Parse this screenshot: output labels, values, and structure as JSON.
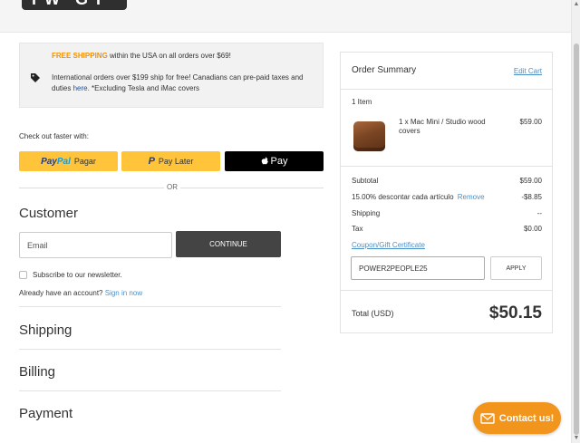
{
  "header": {
    "logo_text": "TW GT"
  },
  "notice": {
    "free_highlight": "FREE SHIPPING",
    "free_rest": " within the USA on all orders over $69!",
    "intl_text_1": "International orders over $199 ship for free! Canadians can pre-paid taxes and duties ",
    "intl_link": "here.",
    "intl_text_2": " *Excluding Tesla and iMac covers",
    "tag_icon": "tag-icon"
  },
  "express": {
    "label": "Check out faster with:",
    "paypal_logo_1": "Pay",
    "paypal_logo_2": "Pal",
    "paypal_suffix": "Pagar",
    "paylater_logo": "P",
    "paylater_label": "Pay Later",
    "applepay_label": "Pay",
    "or": "OR"
  },
  "customer": {
    "heading": "Customer",
    "email_placeholder": "Email",
    "continue_label": "CONTINUE",
    "subscribe_label": "Subscribe to our newsletter.",
    "already_text": "Already have an account? ",
    "sign_in": "Sign in now"
  },
  "sections": {
    "shipping": "Shipping",
    "billing": "Billing",
    "payment": "Payment"
  },
  "summary": {
    "title": "Order Summary",
    "edit_cart": "Edit Cart",
    "item_count": "1 Item",
    "product_name": "1 x Mac Mini / Studio wood covers",
    "product_price": "$59.00",
    "subtotal_label": "Subtotal",
    "subtotal_value": "$59.00",
    "discount_label": "15.00% descontar cada artículo",
    "discount_remove": "Remove",
    "discount_value": "-$8.85",
    "shipping_label": "Shipping",
    "shipping_value": "--",
    "tax_label": "Tax",
    "tax_value": "$0.00",
    "coupon_link": "Coupon/Gift Certificate",
    "coupon_value": "POWER2PEOPLE25",
    "apply_label": "APPLY",
    "total_label": "Total (USD)",
    "total_value": "$50.15"
  },
  "contact": {
    "label": "Contact us!",
    "icon": "mail-icon"
  },
  "colors": {
    "accent_orange": "#f2951c",
    "link_blue": "#4a90c8",
    "paypal_yellow": "#ffc439",
    "dark_button": "#444444"
  }
}
